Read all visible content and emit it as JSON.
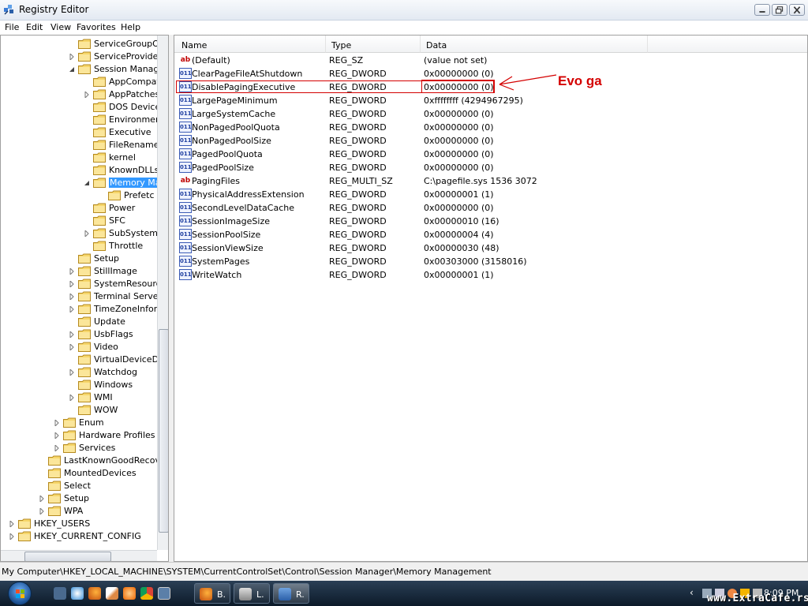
{
  "window": {
    "title": "Registry Editor",
    "icon": "registry-editor-icon"
  },
  "menu": [
    "File",
    "Edit",
    "View",
    "Favorites",
    "Help"
  ],
  "tree": {
    "items": [
      {
        "label": "ServiceGroupOr",
        "depth": 4,
        "expander": "none"
      },
      {
        "label": "ServiceProvider",
        "depth": 4,
        "expander": "plus"
      },
      {
        "label": "Session Manage",
        "depth": 4,
        "expander": "minus"
      },
      {
        "label": "AppCompat",
        "depth": 5,
        "expander": "none"
      },
      {
        "label": "AppPatches",
        "depth": 5,
        "expander": "plus"
      },
      {
        "label": "DOS Device",
        "depth": 5,
        "expander": "none"
      },
      {
        "label": "Environmen",
        "depth": 5,
        "expander": "none"
      },
      {
        "label": "Executive",
        "depth": 5,
        "expander": "none"
      },
      {
        "label": "FileRename",
        "depth": 5,
        "expander": "none"
      },
      {
        "label": "kernel",
        "depth": 5,
        "expander": "none"
      },
      {
        "label": "KnownDLLs",
        "depth": 5,
        "expander": "none"
      },
      {
        "label": "Memory Ma",
        "depth": 5,
        "expander": "minus",
        "selected": true
      },
      {
        "label": "Prefetc",
        "depth": 6,
        "expander": "none"
      },
      {
        "label": "Power",
        "depth": 5,
        "expander": "none"
      },
      {
        "label": "SFC",
        "depth": 5,
        "expander": "none"
      },
      {
        "label": "SubSystems",
        "depth": 5,
        "expander": "plus"
      },
      {
        "label": "Throttle",
        "depth": 5,
        "expander": "none"
      },
      {
        "label": "Setup",
        "depth": 4,
        "expander": "none"
      },
      {
        "label": "StillImage",
        "depth": 4,
        "expander": "plus"
      },
      {
        "label": "SystemResourc",
        "depth": 4,
        "expander": "plus"
      },
      {
        "label": "Terminal Server",
        "depth": 4,
        "expander": "plus"
      },
      {
        "label": "TimeZoneInforn",
        "depth": 4,
        "expander": "plus"
      },
      {
        "label": "Update",
        "depth": 4,
        "expander": "none"
      },
      {
        "label": "UsbFlags",
        "depth": 4,
        "expander": "plus"
      },
      {
        "label": "Video",
        "depth": 4,
        "expander": "plus"
      },
      {
        "label": "VirtualDeviceDri",
        "depth": 4,
        "expander": "none"
      },
      {
        "label": "Watchdog",
        "depth": 4,
        "expander": "plus"
      },
      {
        "label": "Windows",
        "depth": 4,
        "expander": "none"
      },
      {
        "label": "WMI",
        "depth": 4,
        "expander": "plus"
      },
      {
        "label": "WOW",
        "depth": 4,
        "expander": "none"
      },
      {
        "label": "Enum",
        "depth": 3,
        "expander": "plus"
      },
      {
        "label": "Hardware Profiles",
        "depth": 3,
        "expander": "plus"
      },
      {
        "label": "Services",
        "depth": 3,
        "expander": "plus"
      },
      {
        "label": "LastKnownGoodRecove",
        "depth": 2,
        "expander": "none"
      },
      {
        "label": "MountedDevices",
        "depth": 2,
        "expander": "none"
      },
      {
        "label": "Select",
        "depth": 2,
        "expander": "none"
      },
      {
        "label": "Setup",
        "depth": 2,
        "expander": "plus"
      },
      {
        "label": "WPA",
        "depth": 2,
        "expander": "plus"
      },
      {
        "label": "HKEY_USERS",
        "depth": 0,
        "expander": "plus"
      },
      {
        "label": "HKEY_CURRENT_CONFIG",
        "depth": 0,
        "expander": "plus"
      }
    ]
  },
  "list": {
    "columns": [
      "Name",
      "Type",
      "Data"
    ],
    "rows": [
      {
        "name": "(Default)",
        "type": "REG_SZ",
        "data": "(value not set)",
        "icon": "string-value-icon"
      },
      {
        "name": "ClearPageFileAtShutdown",
        "type": "REG_DWORD",
        "data": "0x00000000 (0)",
        "icon": "binary-value-icon"
      },
      {
        "name": "DisablePagingExecutive",
        "type": "REG_DWORD",
        "data": "0x00000000 (0)",
        "icon": "binary-value-icon"
      },
      {
        "name": "LargePageMinimum",
        "type": "REG_DWORD",
        "data": "0xffffffff (4294967295)",
        "icon": "binary-value-icon"
      },
      {
        "name": "LargeSystemCache",
        "type": "REG_DWORD",
        "data": "0x00000000 (0)",
        "icon": "binary-value-icon"
      },
      {
        "name": "NonPagedPoolQuota",
        "type": "REG_DWORD",
        "data": "0x00000000 (0)",
        "icon": "binary-value-icon"
      },
      {
        "name": "NonPagedPoolSize",
        "type": "REG_DWORD",
        "data": "0x00000000 (0)",
        "icon": "binary-value-icon"
      },
      {
        "name": "PagedPoolQuota",
        "type": "REG_DWORD",
        "data": "0x00000000 (0)",
        "icon": "binary-value-icon"
      },
      {
        "name": "PagedPoolSize",
        "type": "REG_DWORD",
        "data": "0x00000000 (0)",
        "icon": "binary-value-icon"
      },
      {
        "name": "PagingFiles",
        "type": "REG_MULTI_SZ",
        "data": "C:\\pagefile.sys 1536 3072",
        "icon": "string-value-icon"
      },
      {
        "name": "PhysicalAddressExtension",
        "type": "REG_DWORD",
        "data": "0x00000001 (1)",
        "icon": "binary-value-icon"
      },
      {
        "name": "SecondLevelDataCache",
        "type": "REG_DWORD",
        "data": "0x00000000 (0)",
        "icon": "binary-value-icon"
      },
      {
        "name": "SessionImageSize",
        "type": "REG_DWORD",
        "data": "0x00000010 (16)",
        "icon": "binary-value-icon"
      },
      {
        "name": "SessionPoolSize",
        "type": "REG_DWORD",
        "data": "0x00000004 (4)",
        "icon": "binary-value-icon"
      },
      {
        "name": "SessionViewSize",
        "type": "REG_DWORD",
        "data": "0x00000030 (48)",
        "icon": "binary-value-icon"
      },
      {
        "name": "SystemPages",
        "type": "REG_DWORD",
        "data": "0x00303000 (3158016)",
        "icon": "binary-value-icon"
      },
      {
        "name": "WriteWatch",
        "type": "REG_DWORD",
        "data": "0x00000001 (1)",
        "icon": "binary-value-icon"
      }
    ]
  },
  "annotation": {
    "text": "Evo ga",
    "color": "#d40000"
  },
  "status": {
    "path": "My Computer\\HKEY_LOCAL_MACHINE\\SYSTEM\\CurrentControlSet\\Control\\Session Manager\\Memory Management"
  },
  "taskbar": {
    "quick_launch": [
      "show-desktop-icon",
      "msn-icon",
      "firefox-icon",
      "paint-icon",
      "media-icon",
      "chrome-icon",
      "switch-windows-icon"
    ],
    "buttons": [
      {
        "label": "B.",
        "icon": "firefox-icon"
      },
      {
        "label": "L.",
        "icon": "network-drive-icon"
      },
      {
        "label": "R.",
        "icon": "registry-editor-icon",
        "active": true
      }
    ],
    "clock": "8:09 PM",
    "watermark": "www.ExtraCafe.rs"
  },
  "colors": {
    "selection": "#3399ff",
    "highlight": "#d40000",
    "taskbar": "#0c1a29"
  }
}
